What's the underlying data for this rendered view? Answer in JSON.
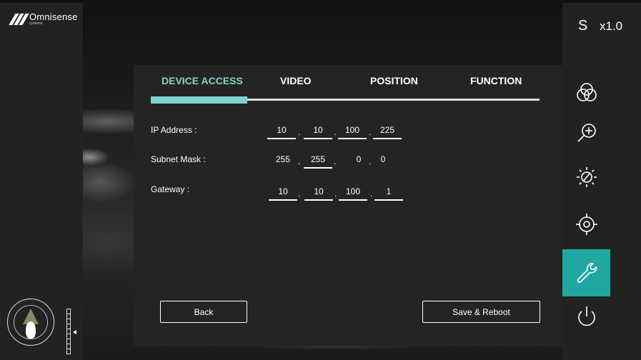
{
  "brand": {
    "name": "Omnisense",
    "sub": "systems"
  },
  "status": {
    "mode": "S",
    "zoom": "x1.0"
  },
  "tools": [
    {
      "name": "color-palette-icon"
    },
    {
      "name": "zoom-in-icon"
    },
    {
      "name": "brightness-icon"
    },
    {
      "name": "target-icon"
    },
    {
      "name": "wrench-icon",
      "active": true
    },
    {
      "name": "power-icon"
    }
  ],
  "tabs": [
    {
      "label": "DEVICE ACCESS",
      "active": true,
      "color": "#7fd3cc"
    },
    {
      "label": "VIDEO"
    },
    {
      "label": "POSITION"
    },
    {
      "label": "FUNCTION"
    }
  ],
  "fields": {
    "ip": {
      "label": "IP Address :",
      "octets": [
        "10",
        "10",
        "100",
        "225"
      ]
    },
    "subnet": {
      "label": "Subnet Mask :",
      "octets": [
        "255",
        "255",
        "0",
        "0"
      ]
    },
    "gateway": {
      "label": "Gateway :",
      "octets": [
        "10",
        "10",
        "100",
        "1"
      ]
    }
  },
  "buttons": {
    "back": "Back",
    "save": "Save & Reboot"
  },
  "colors": {
    "accent": "#1fa7a2",
    "tab_active": "#7fd3cc",
    "panel": "#262324",
    "sidebar": "#222222"
  }
}
